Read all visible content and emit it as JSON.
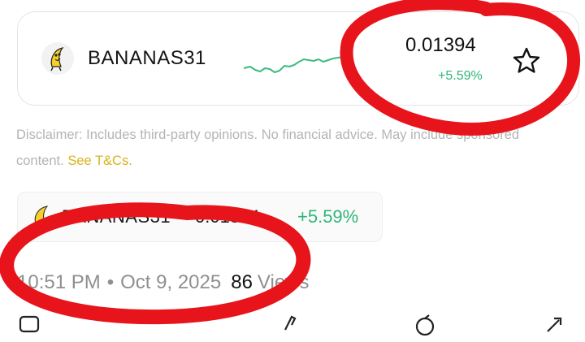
{
  "card": {
    "name": "BANANAS31",
    "price": "0.01394",
    "change": "+5.59%",
    "avatar_icon": "banana-mascot-icon",
    "favorite_icon": "star-icon"
  },
  "disclaimer": {
    "text": "Disclaimer: Includes third-party opinions. No financial advice. May include sponsored content.",
    "link_label": "See T&Cs."
  },
  "chip": {
    "name": "BANANAS31",
    "price": "0.01394",
    "change": "+5.59%"
  },
  "meta": {
    "time": "10:51 PM",
    "separator": "•",
    "date": "Oct 9, 2025",
    "views_count": "86",
    "views_label": "Views"
  },
  "colors": {
    "positive": "#2fb67a",
    "link": "#d9b21b",
    "annotation": "#e8141b"
  }
}
